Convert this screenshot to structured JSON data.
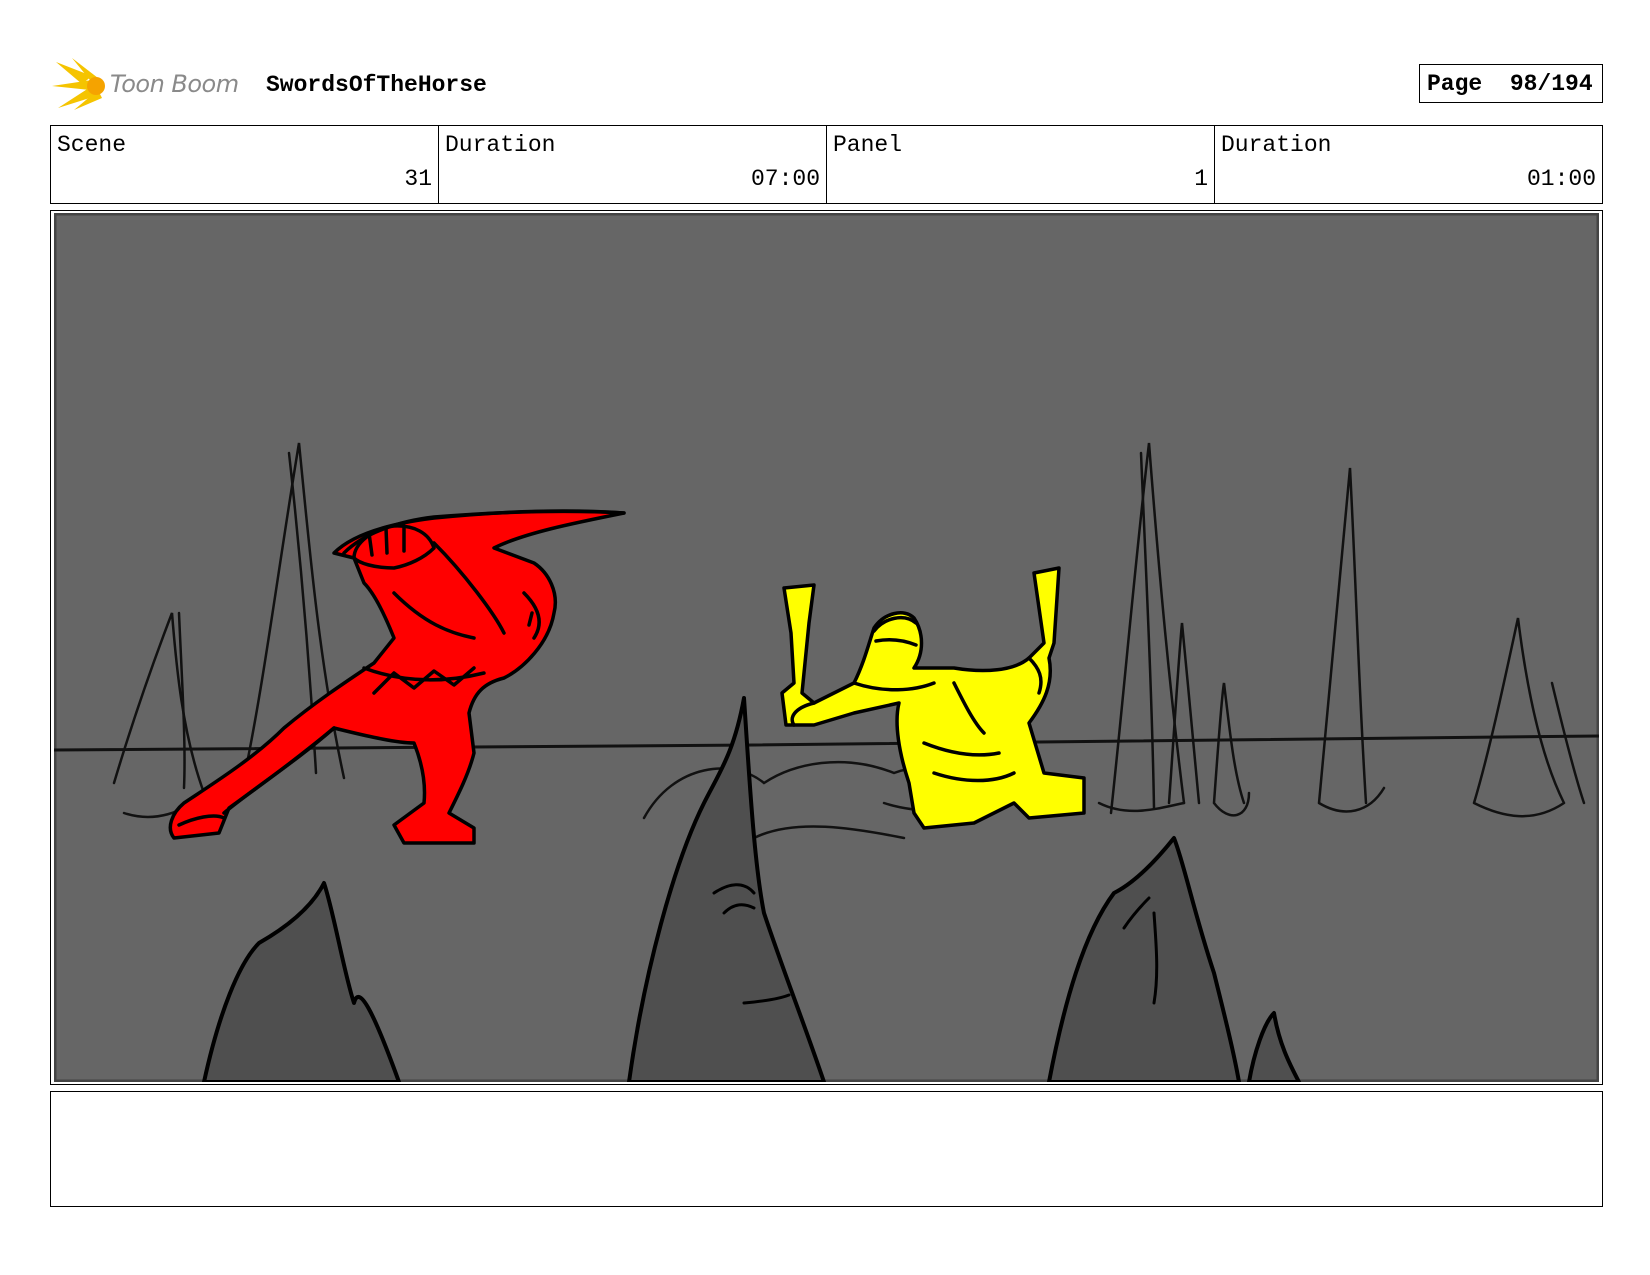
{
  "header": {
    "logo_text": "Toon Boom",
    "project_title": "SwordsOfTheHorse",
    "page_label": "Page",
    "page_value": "98/194"
  },
  "info": {
    "scene_label": "Scene",
    "scene_value": "31",
    "scene_duration_label": "Duration",
    "scene_duration_value": "07:00",
    "panel_label": "Panel",
    "panel_value": "1",
    "panel_duration_label": "Duration",
    "panel_duration_value": "01:00"
  },
  "notes": {
    "text": ""
  },
  "colors": {
    "panel_background": "#666666",
    "rock_fill": "#4f4f4f",
    "red_fighter": "#ff0000",
    "yellow_fighter": "#ffff00",
    "logo_burst": "#f5c400"
  }
}
